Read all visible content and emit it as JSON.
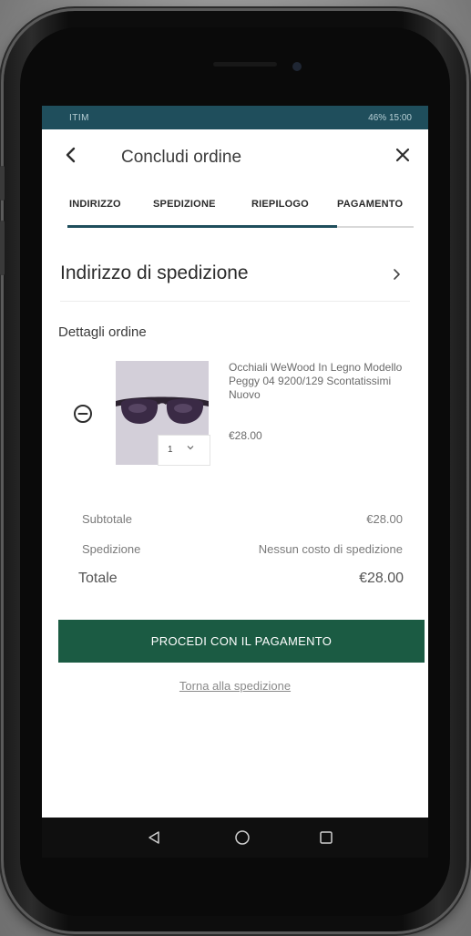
{
  "status_bar": {
    "carrier": "ITIM",
    "right_text": "46% 15:00"
  },
  "header": {
    "title": "Concludi ordine"
  },
  "tabs": [
    {
      "label": "INDIRIZZO"
    },
    {
      "label": "SPEDIZIONE"
    },
    {
      "label": "RIEPILOGO"
    },
    {
      "label": "PAGAMENTO"
    }
  ],
  "shipping_section": {
    "title": "Indirizzo di spedizione"
  },
  "order": {
    "label": "Dettagli ordine",
    "item": {
      "name": "Occhiali WeWood In Legno Modello Peggy 04 9200/129 Scontatissimi Nuovo",
      "price": "€28.00",
      "quantity": "1"
    }
  },
  "summary": {
    "subtotal_label": "Subtotale",
    "subtotal_value": "€28.00",
    "shipping_label": "Spedizione",
    "shipping_value": "Nessun costo di spedizione",
    "total_label": "Totale",
    "total_value": "€28.00"
  },
  "actions": {
    "pay_button": "PROCEDI CON IL PAGAMENTO",
    "back_link": "Torna alla spedizione"
  },
  "colors": {
    "accent": "#1f4e5c",
    "primary_button": "#1b5b43"
  }
}
